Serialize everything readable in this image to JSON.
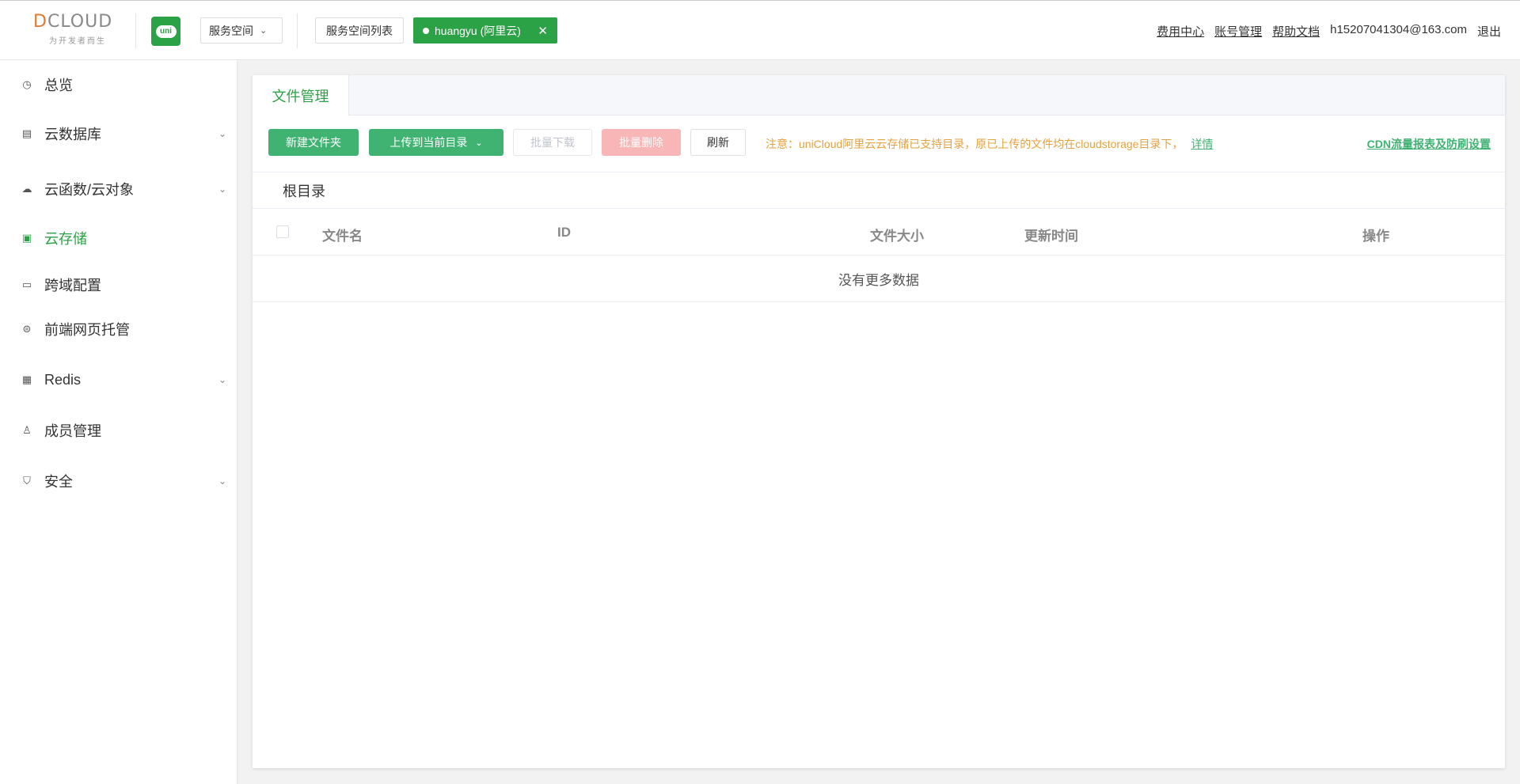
{
  "header": {
    "logo": "DCLOUD",
    "logo_sub": "为开发者而生",
    "uni_badge": "uni",
    "space_select": "服务空间",
    "space_list": "服务空间列表",
    "active_space": "huangyu (阿里云)",
    "links": [
      "费用中心",
      "账号管理",
      "帮助文档"
    ],
    "account": "h15207041304@163.com",
    "logout": "退出"
  },
  "sidebar": {
    "items": [
      {
        "label": "总览",
        "icon": "clock-icon"
      },
      {
        "label": "云数据库",
        "icon": "database-icon"
      },
      {
        "label": "云函数/云对象",
        "icon": "cloud-icon"
      },
      {
        "label": "云存储",
        "icon": "storage-icon"
      },
      {
        "label": "跨域配置",
        "icon": "card-icon"
      },
      {
        "label": "前端网页托管",
        "icon": "web-icon"
      },
      {
        "label": "Redis",
        "icon": "redis-icon"
      },
      {
        "label": "成员管理",
        "icon": "user-icon"
      },
      {
        "label": "安全",
        "icon": "shield-icon"
      }
    ]
  },
  "main": {
    "tab": "文件管理",
    "toolbar": {
      "new_folder": "新建文件夹",
      "upload": "上传到当前目录",
      "batch_download": "批量下载",
      "batch_delete": "批量删除",
      "refresh": "刷新"
    },
    "notice": "注意：uniCloud阿里云云存储已支持目录，原已上传的文件均在cloudstorage目录下，",
    "notice_link": "详情",
    "cdn_link": "CDN流量报表及防刷设置",
    "breadcrumb": "根目录",
    "columns": [
      "文件名",
      "ID",
      "文件大小",
      "更新时间",
      "操作"
    ],
    "empty_text": "没有更多数据"
  },
  "colors": {
    "brand": "#2ba245",
    "primary_button": "#40b373",
    "notice": "#e6a23c",
    "danger_disabled": "#f9b6b6"
  }
}
